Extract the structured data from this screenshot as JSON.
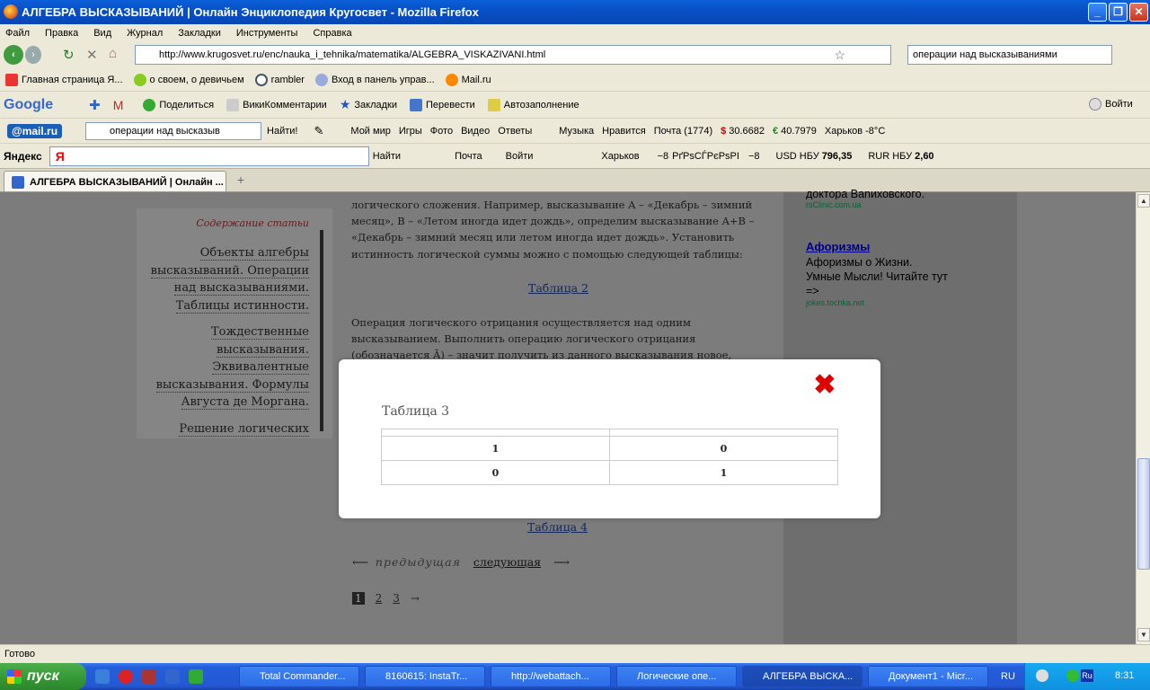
{
  "window": {
    "title": "АЛГЕБРА ВЫСКАЗЫВАНИЙ | Онлайн Энциклопедия Кругосвет - Mozilla Firefox"
  },
  "menu": [
    "Файл",
    "Правка",
    "Вид",
    "Журнал",
    "Закладки",
    "Инструменты",
    "Справка"
  ],
  "nav": {
    "url": "http://www.krugosvet.ru/enc/nauka_i_tehnika/matematika/ALGEBRA_VISKAZIVANI.html",
    "search": "операции над высказываниями"
  },
  "bookmarks": [
    "Главная страница Я...",
    "о своем, о девичьем",
    "rambler",
    "Вход в панель управ...",
    "Mail.ru"
  ],
  "google_bar": {
    "logo": "Google",
    "items": [
      "Поделиться",
      "ВикиКомментарии",
      "Закладки",
      "Перевести",
      "Автозаполнение"
    ],
    "login": "Войти"
  },
  "mail_bar": {
    "logo": "@mail.ru",
    "query": "операции над высказыв",
    "find": "Найти!",
    "items": [
      "Мой мир",
      "Игры",
      "Фото",
      "Видео",
      "Ответы",
      "Музыка",
      "Нравится",
      "Почта (1774)",
      "30.6682",
      "40.7979",
      "Харьков -8°C"
    ]
  },
  "yandex_bar": {
    "logo": "Яндекс",
    "find": "Найти",
    "items": [
      "Почта",
      "Войти",
      "Харьков",
      "−8",
      "РґРѕСЃРєРѕРІ",
      "−8"
    ],
    "usd_label": "USD НБУ",
    "usd_value": "796,35",
    "rur_label": "RUR НБУ",
    "rur_value": "2,60"
  },
  "tab": {
    "label": "АЛГЕБРА ВЫСКАЗЫВАНИЙ | Онлайн ..."
  },
  "toc": {
    "title": "Содержание статьи",
    "items": [
      "Объекты алгебры высказываний. Операции над высказываниями. Таблицы истинности.",
      "Тождественные высказывания. Эквивалентные высказывания. Формулы Августа де Моргана.",
      "Решение логических задач."
    ]
  },
  "article": {
    "p1": "логического сложения. Например, высказывание A – «Декабрь – зимний месяц», B – «Летом иногда идет дождь», определим высказывание A+B – «Декабрь – зимний месяц или летом иногда идет дождь». Установить истинность логической суммы можно с помощью следующей таблицы:",
    "table2": "Таблица 2",
    "p2": "Операция логического отрицания осуществляется над одним высказыванием. Выполнить операцию логического отрицания (обозначается Ā) – значит получить из данного высказывания новое,",
    "table4": "Таблица 4",
    "prev": "предыдущая",
    "next": "следующая",
    "pages": [
      "1",
      "2",
      "3",
      "→"
    ]
  },
  "ads": {
    "top_text": "доктора Ваnиховского.",
    "top_url": "rsClinic.com.ua",
    "title": "Афоризмы",
    "text": "Афоризмы о Жизни. Умные Мысли! Читайте тут =>",
    "url": "jokes.tochka.net"
  },
  "modal": {
    "title": "Таблица 3",
    "rows": [
      [
        "1",
        "0"
      ],
      [
        "0",
        "1"
      ]
    ]
  },
  "status": "Готово",
  "taskbar": {
    "start": "пуск",
    "tasks": [
      "Total Commander...",
      "8160615: InstaTr...",
      "http://webattach...",
      "Логические опе...",
      "АЛГЕБРА ВЫСКА...",
      "Документ1 - Micr..."
    ],
    "lang": "RU",
    "clock": "8:31"
  }
}
